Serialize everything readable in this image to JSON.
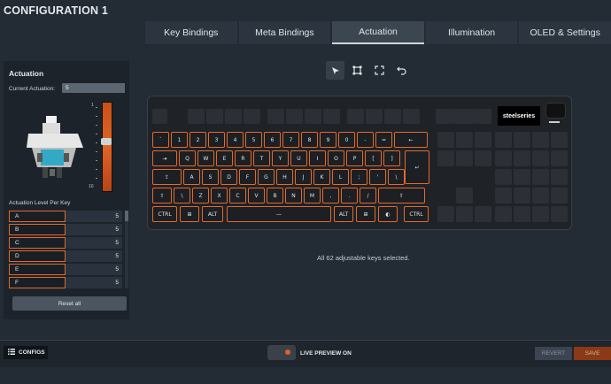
{
  "header": {
    "title": "CONFIGURATION 1"
  },
  "tabs": [
    {
      "label": "Key Bindings",
      "active": false
    },
    {
      "label": "Meta Bindings",
      "active": false
    },
    {
      "label": "Actuation",
      "active": true
    },
    {
      "label": "Illumination",
      "active": false
    },
    {
      "label": "OLED & Settings",
      "active": false
    }
  ],
  "actuation": {
    "heading": "Actuation",
    "current_label": "Current Actuation:",
    "current_value": "5",
    "slider": {
      "top_label": "1",
      "bottom_label": "10",
      "value": 5
    },
    "per_key_label": "Actuation Level Per Key",
    "keys": [
      {
        "name": "A",
        "value": "5"
      },
      {
        "name": "B",
        "value": "5"
      },
      {
        "name": "C",
        "value": "5"
      },
      {
        "name": "D",
        "value": "5"
      },
      {
        "name": "E",
        "value": "5"
      },
      {
        "name": "F",
        "value": "5"
      }
    ],
    "reset_label": "Reset all"
  },
  "toolbar": [
    "cursor-icon",
    "select-box-icon",
    "expand-icon",
    "undo-icon"
  ],
  "keyboard": {
    "brand": "steelseries",
    "rows": [
      [
        "`",
        "1",
        "2",
        "3",
        "4",
        "5",
        "6",
        "7",
        "8",
        "9",
        "0",
        "-",
        "=",
        "←"
      ],
      [
        "⇥",
        "Q",
        "W",
        "E",
        "R",
        "T",
        "Y",
        "U",
        "I",
        "O",
        "P",
        "[",
        "]",
        "↵"
      ],
      [
        "⇪",
        "A",
        "S",
        "D",
        "F",
        "G",
        "H",
        "J",
        "K",
        "L",
        ";",
        "'",
        "\\"
      ],
      [
        "⇧",
        "\\",
        "Z",
        "X",
        "C",
        "V",
        "B",
        "N",
        "M",
        ",",
        ".",
        "/",
        "⇧"
      ],
      [
        "CTRL",
        "⊞",
        "ALT",
        "—",
        "ALT",
        "⊞",
        "◐",
        "CTRL"
      ]
    ]
  },
  "status": "All 62 adjustable keys selected.",
  "footer": {
    "configs_label": "CONFIGS",
    "live_preview": "LIVE PREVIEW ON",
    "revert": "REVERT",
    "save": "SAVE"
  },
  "colors": {
    "accent": "#e26a2b",
    "background": "#232b34",
    "panel": "#1c232b"
  }
}
